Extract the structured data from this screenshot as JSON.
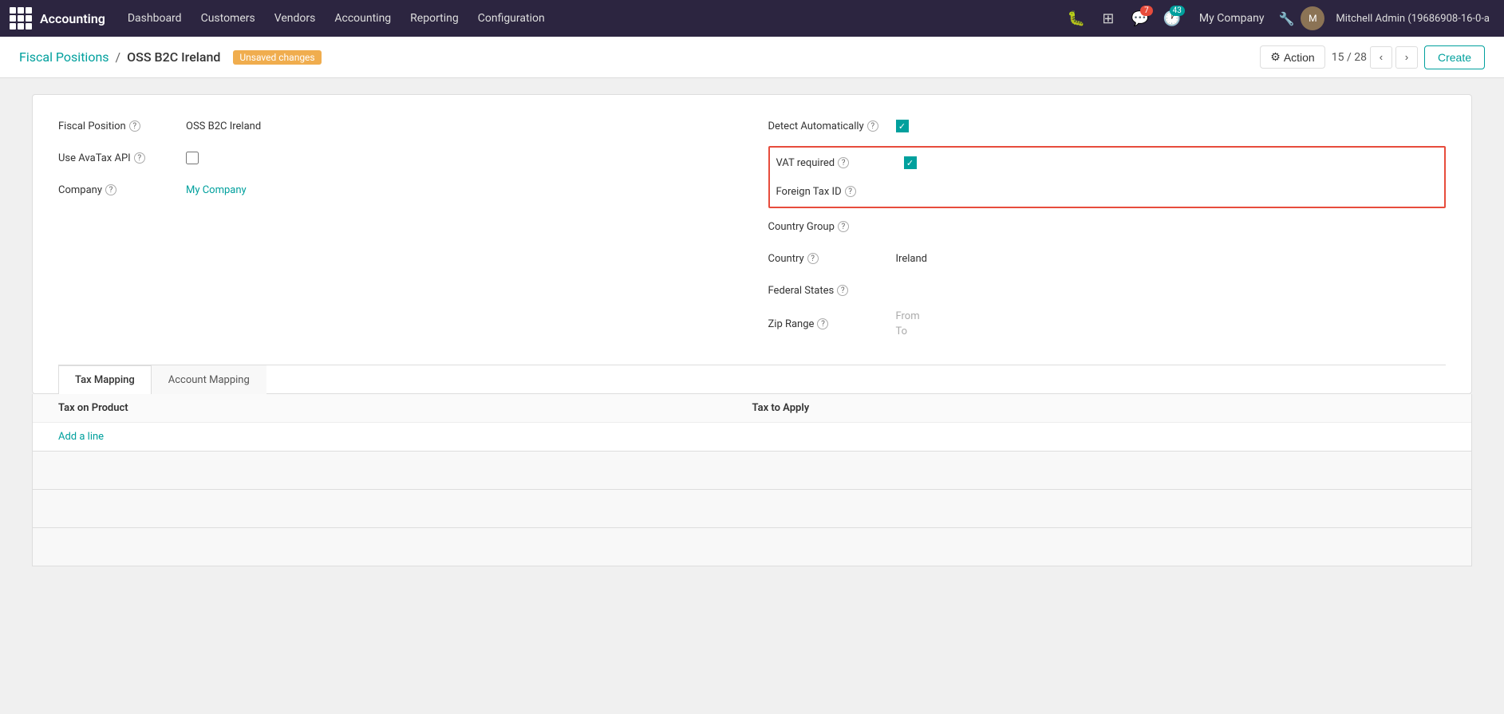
{
  "topNav": {
    "appName": "Accounting",
    "menuItems": [
      "Dashboard",
      "Customers",
      "Vendors",
      "Accounting",
      "Reporting",
      "Configuration"
    ],
    "notifications": {
      "chat": "7",
      "clock": "43"
    },
    "company": "My Company",
    "userName": "Mitchell Admin (19686908-16-0-a"
  },
  "breadcrumb": {
    "parent": "Fiscal Positions",
    "separator": "/",
    "current": "OSS B2C Ireland",
    "unsaved": "Unsaved changes"
  },
  "pager": {
    "current": "15",
    "total": "28"
  },
  "buttons": {
    "action": "Action",
    "create": "Create"
  },
  "form": {
    "leftFields": [
      {
        "label": "Fiscal Position",
        "help": true,
        "value": "OSS B2C Ireland",
        "type": "text"
      },
      {
        "label": "Use AvaTax API",
        "help": true,
        "value": "",
        "type": "checkbox",
        "checked": false
      },
      {
        "label": "Company",
        "help": true,
        "value": "My Company",
        "type": "link"
      }
    ],
    "rightFields": [
      {
        "label": "Detect Automatically",
        "help": true,
        "type": "checkbox-teal",
        "checked": true,
        "highlighted": false
      },
      {
        "label": "VAT required",
        "help": true,
        "type": "checkbox-teal",
        "checked": true,
        "highlighted": true
      },
      {
        "label": "Foreign Tax ID",
        "help": true,
        "type": "text",
        "value": "",
        "highlighted": true
      },
      {
        "label": "Country Group",
        "help": true,
        "type": "text",
        "value": ""
      },
      {
        "label": "Country",
        "help": true,
        "type": "text",
        "value": "Ireland"
      },
      {
        "label": "Federal States",
        "help": true,
        "type": "text",
        "value": ""
      },
      {
        "label": "Zip Range",
        "help": true,
        "type": "from-to",
        "from": "From",
        "to": "To"
      }
    ]
  },
  "tabs": [
    {
      "id": "tax-mapping",
      "label": "Tax Mapping",
      "active": true
    },
    {
      "id": "account-mapping",
      "label": "Account Mapping",
      "active": false
    }
  ],
  "table": {
    "headers": [
      "Tax on Product",
      "Tax to Apply"
    ],
    "addLine": "Add a line"
  }
}
